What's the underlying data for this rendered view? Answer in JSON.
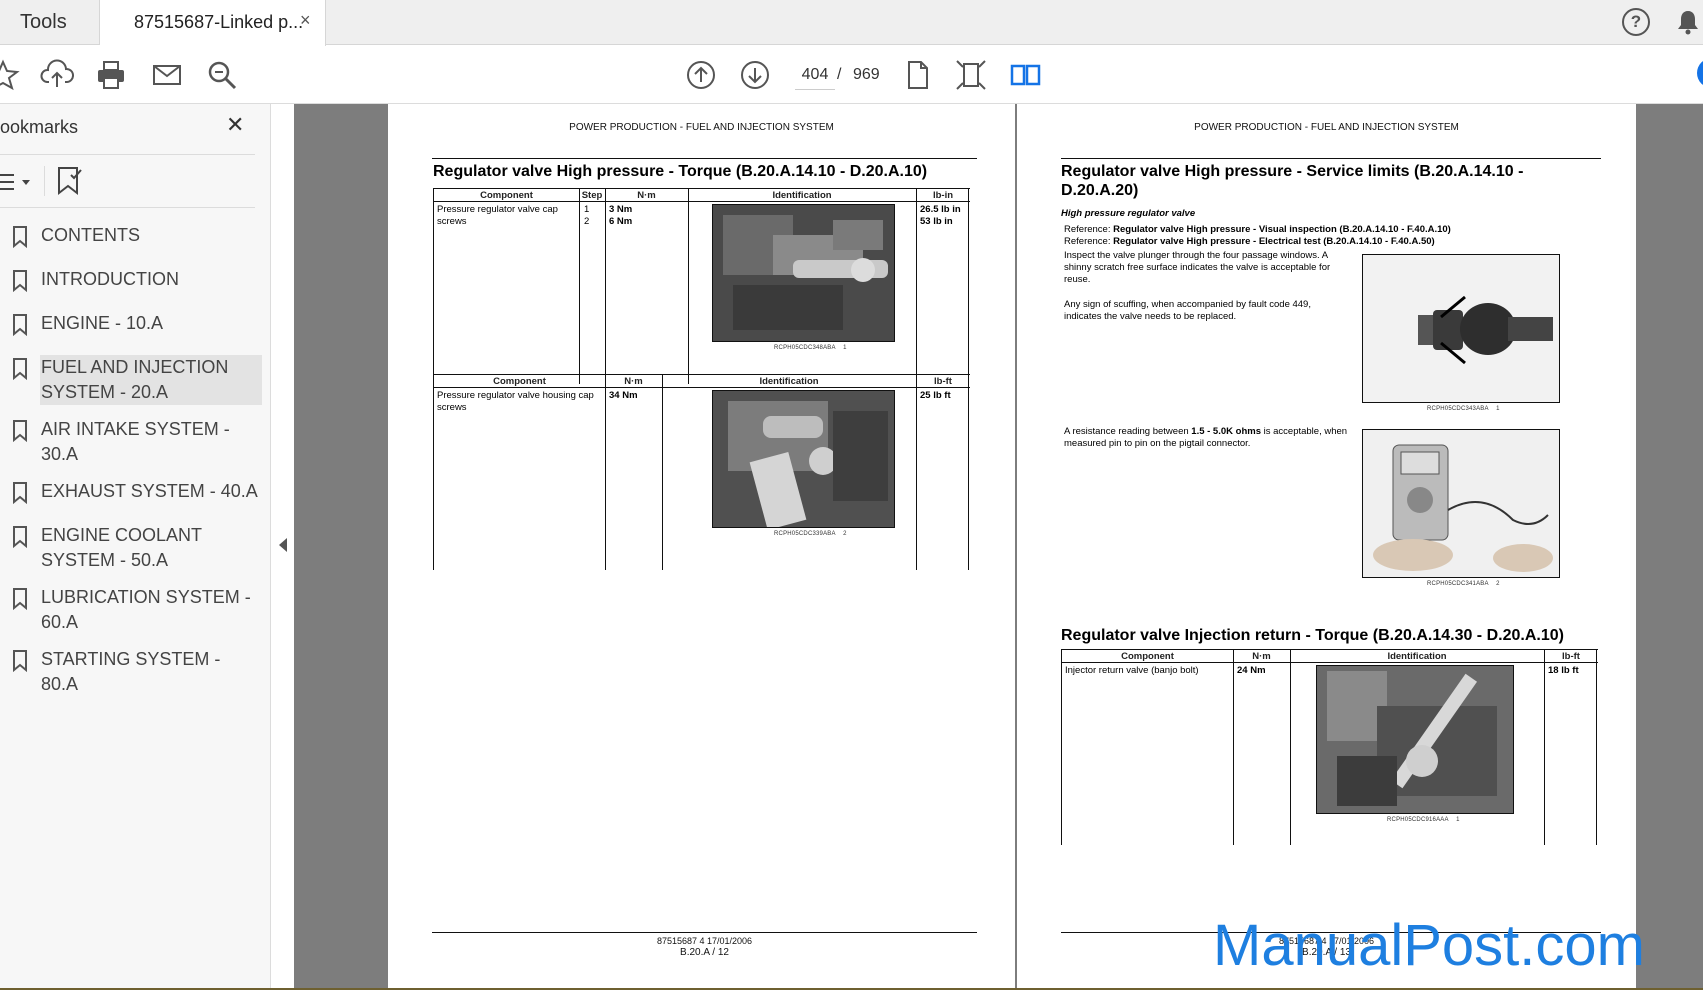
{
  "tabs": {
    "tools_label": "Tools",
    "doc_label": "87515687-Linked p...",
    "close_glyph": "×"
  },
  "toolbar": {
    "current_page": "404",
    "separator": "/",
    "total_pages": "969",
    "icons": [
      "star-icon",
      "upload-icon",
      "print-icon",
      "email-icon",
      "zoom-icon",
      "page-up-icon",
      "page-down-icon",
      "single-page-icon",
      "fit-icon",
      "two-page-icon"
    ]
  },
  "sidebar": {
    "title": "ookmarks",
    "close_glyph": "✕",
    "items": [
      {
        "label": "CONTENTS",
        "selected": false
      },
      {
        "label": "INTRODUCTION",
        "selected": false
      },
      {
        "label": "ENGINE - 10.A",
        "selected": false
      },
      {
        "label": "FUEL AND INJECTION SYSTEM - 20.A",
        "selected": true
      },
      {
        "label": "AIR INTAKE SYSTEM - 30.A",
        "selected": false
      },
      {
        "label": "EXHAUST SYSTEM - 40.A",
        "selected": false
      },
      {
        "label": "ENGINE COOLANT SYSTEM - 50.A",
        "selected": false
      },
      {
        "label": "LUBRICATION SYSTEM - 60.A",
        "selected": false
      },
      {
        "label": "STARTING SYSTEM - 80.A",
        "selected": false
      }
    ]
  },
  "left_page": {
    "header": "POWER PRODUCTION - FUEL AND INJECTION SYSTEM",
    "title": "Regulator valve High pressure - Torque (B.20.A.14.10 - D.20.A.10)",
    "table1": {
      "headers": [
        "Component",
        "Step",
        "N·m",
        "Identification",
        "lb-in"
      ],
      "component": "Pressure regulator valve cap screws",
      "steps": [
        "1",
        "2"
      ],
      "nm": [
        "3 Nm",
        "6 Nm"
      ],
      "lbin": [
        "26.5 lb in",
        "53 lb in"
      ],
      "caption": "RCPH05CDC348ABA",
      "caption_num": "1"
    },
    "table2": {
      "headers": [
        "Component",
        "N·m",
        "Identification",
        "lb-ft"
      ],
      "component": "Pressure regulator valve housing cap screws",
      "nm": "34 Nm",
      "lbft": "25 lb ft",
      "caption": "RCPH05CDC339ABA",
      "caption_num": "2"
    },
    "footer_line1": "87515687 4 17/01/2006",
    "footer_line2": "B.20.A / 12"
  },
  "right_page": {
    "header": "POWER PRODUCTION - FUEL AND INJECTION SYSTEM",
    "title": "Regulator valve High pressure - Service limits (B.20.A.14.10 - D.20.A.20)",
    "subtitle": "High pressure regulator valve",
    "ref1_prefix": "Reference: ",
    "ref1": "Regulator valve High pressure - Visual inspection (B.20.A.14.10 - F.40.A.10)",
    "ref2_prefix": "Reference: ",
    "ref2": "Regulator valve High pressure - Electrical test (B.20.A.14.10 - F.40.A.50)",
    "para1": "Inspect the valve plunger through the four passage windows. A shinny scratch free surface indicates the valve is acceptable for reuse.",
    "para2": "Any sign of scuffing, when accompanied by fault code 449, indicates the valve needs to be replaced.",
    "para3_pre": "A resistance reading between ",
    "para3_bold": "1.5 - 5.0K ohms",
    "para3_post": " is acceptable, when measured pin to pin on the pigtail connector.",
    "cap1": "RCPH05CDC343ABA",
    "cap1_num": "1",
    "cap2": "RCPH05CDC341ABA",
    "cap2_num": "2",
    "title2": "Regulator valve Injection return - Torque (B.20.A.14.30 - D.20.A.10)",
    "table3": {
      "headers": [
        "Component",
        "N·m",
        "Identification",
        "lb-ft"
      ],
      "component": "Injector return valve (banjo bolt)",
      "nm": "24 Nm",
      "lbft": "18 lb ft",
      "caption": "RCPH05CDC916AAA",
      "caption_num": "1"
    },
    "footer_line1": "87515687 4 17/01/2006",
    "footer_line2": "B.20.A / 13"
  },
  "watermark": "ManualPost.com"
}
